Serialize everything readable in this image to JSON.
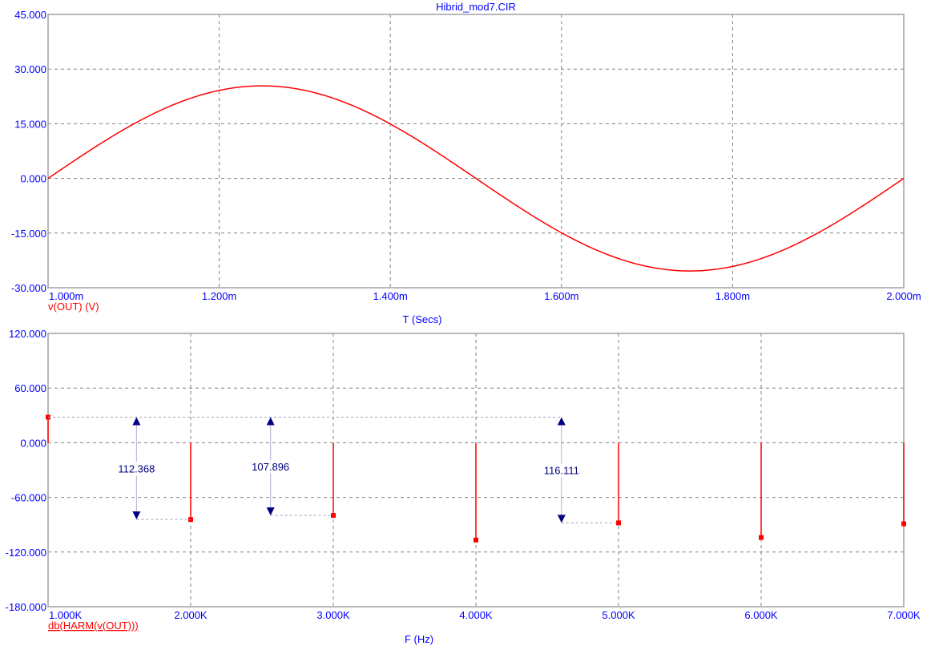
{
  "chart_data": [
    {
      "type": "line",
      "title": "Hibrid_mod7.CIR",
      "xlabel": "T (Secs)",
      "ylabel": "",
      "series_label": "v(OUT) (V)",
      "xlim": [
        1.0,
        2.0
      ],
      "ylim": [
        -30,
        45
      ],
      "xticks": [
        "1.000m",
        "1.200m",
        "1.400m",
        "1.600m",
        "1.800m",
        "2.000m"
      ],
      "yticks": [
        "45.000",
        "30.000",
        "15.000",
        "0.000",
        "-15.000",
        "-30.000"
      ],
      "grid": true,
      "series": [
        {
          "name": "v(OUT)",
          "function": "25.4*sin(2*pi*(t-1m)/1m)",
          "amplitude": 25.4,
          "period_ms": 1.0,
          "color": "#ff0000"
        }
      ]
    },
    {
      "type": "bar",
      "xlabel": "F (Hz)",
      "series_label": "db(HARM(v(OUT)))",
      "xlim": [
        1,
        7
      ],
      "ylim": [
        -180,
        120
      ],
      "xticks": [
        "1.000K",
        "2.000K",
        "3.000K",
        "4.000K",
        "5.000K",
        "6.000K",
        "7.000K"
      ],
      "yticks": [
        "120.000",
        "60.000",
        "0.000",
        "-60.000",
        "-120.000",
        "-180.000"
      ],
      "grid": true,
      "x": [
        1,
        2,
        3,
        4,
        5,
        6,
        7
      ],
      "values": [
        28.1,
        -84.27,
        -79.8,
        -106.8,
        -88.0,
        -104.0,
        -89.0
      ],
      "color": "#ff0000",
      "annotations": [
        {
          "text": "112.368",
          "x": 1.62,
          "from": 28.1,
          "to": -84.27,
          "target_x": 2
        },
        {
          "text": "107.896",
          "x": 2.56,
          "from": 28.1,
          "to": -79.8,
          "target_x": 3
        },
        {
          "text": "116.111",
          "x": 4.6,
          "from": 28.1,
          "to": -88.0,
          "target_x": 5
        }
      ]
    }
  ]
}
